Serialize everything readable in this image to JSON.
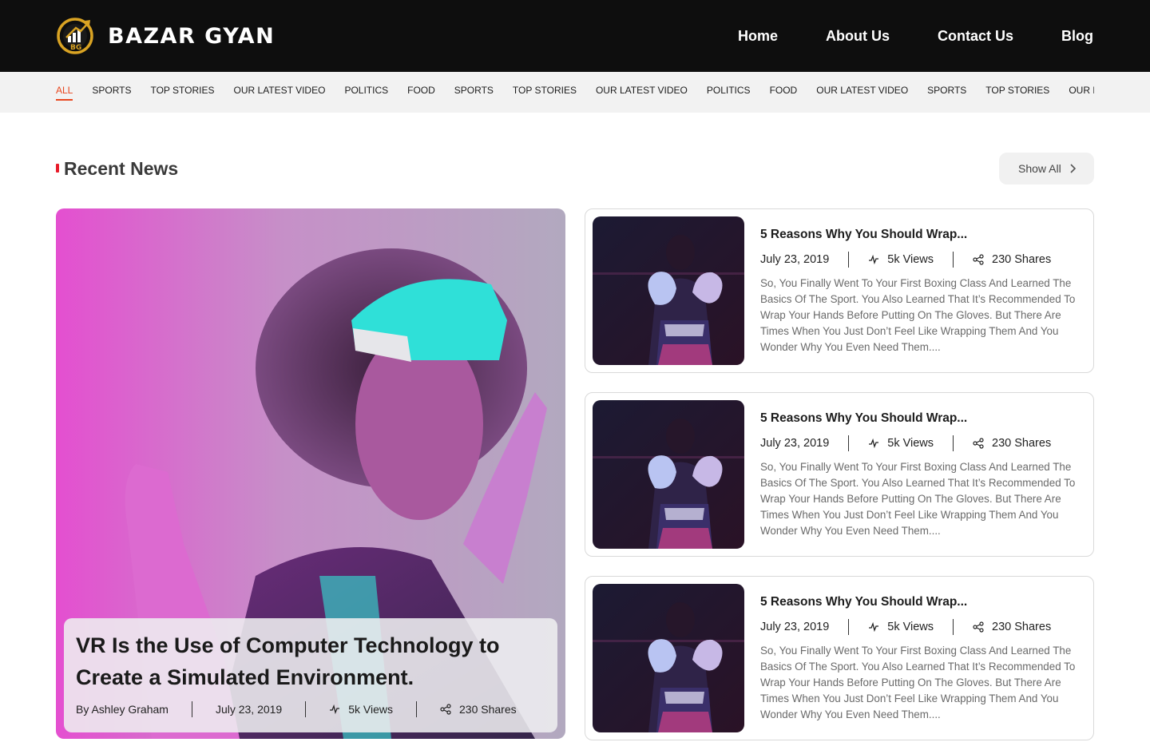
{
  "brand": {
    "name": "BAZAR GYAN",
    "colors": {
      "accent": "#e8471f",
      "gold": "#d9a323",
      "header_bg": "#0e0e0e"
    }
  },
  "nav": {
    "items": [
      "Home",
      "About Us",
      "Contact Us",
      "Blog"
    ]
  },
  "categories": [
    "ALL",
    "SPORTS",
    "TOP STORIES",
    "OUR LATEST VIDEO",
    "POLITICS",
    "FOOD",
    "SPORTS",
    "TOP STORIES",
    "OUR LATEST VIDEO",
    "POLITICS",
    "FOOD",
    "OUR LATEST VIDEO",
    "SPORTS",
    "TOP STORIES",
    "OUR LATEST VIDEO"
  ],
  "section": {
    "title": "Recent News",
    "show_all": "Show All"
  },
  "featured": {
    "title": "VR Is the Use of Computer Technology to Create a Simulated Environment.",
    "author": "By Ashley Graham",
    "date": "July 23, 2019",
    "views": "5k Views",
    "shares": "230 Shares"
  },
  "articles": [
    {
      "title": "5 Reasons Why You Should Wrap...",
      "date": "July 23, 2019",
      "views": "5k Views",
      "shares": "230 Shares",
      "excerpt": "So, You Finally Went To Your First Boxing Class And Learned The Basics Of The Sport. You Also Learned That It’s Recommended To Wrap Your Hands Before Putting On The Gloves. But There Are Times When You Just Don’t Feel Like Wrapping Them And You Wonder Why You Even Need Them...."
    },
    {
      "title": "5 Reasons Why You Should Wrap...",
      "date": "July 23, 2019",
      "views": "5k Views",
      "shares": "230 Shares",
      "excerpt": "So, You Finally Went To Your First Boxing Class And Learned The Basics Of The Sport. You Also Learned That It’s Recommended To Wrap Your Hands Before Putting On The Gloves. But There Are Times When You Just Don’t Feel Like Wrapping Them And You Wonder Why You Even Need Them...."
    },
    {
      "title": "5 Reasons Why You Should Wrap...",
      "date": "July 23, 2019",
      "views": "5k Views",
      "shares": "230 Shares",
      "excerpt": "So, You Finally Went To Your First Boxing Class And Learned The Basics Of The Sport. You Also Learned That It’s Recommended To Wrap Your Hands Before Putting On The Gloves. But There Are Times When You Just Don’t Feel Like Wrapping Them And You Wonder Why You Even Need Them...."
    }
  ],
  "icons": {
    "views": "activity-icon",
    "shares": "share-icon",
    "show_all": "chevron-right-icon"
  }
}
